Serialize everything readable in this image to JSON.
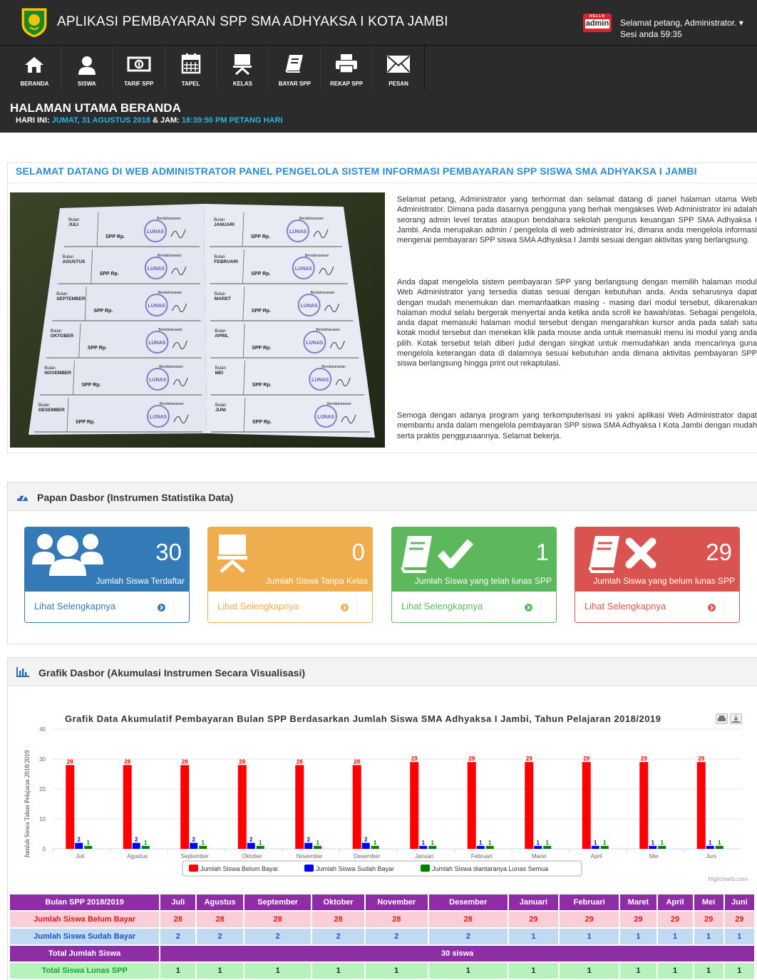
{
  "header": {
    "app_title": "APLIKASI PEMBAYARAN SPP SMA ADHYAKSA I KOTA JAMBI",
    "badge_hello": "HELLO",
    "badge_admin": "admin",
    "greeting": "Selamat petang, Administrator. ▾",
    "session": "Sesi anda 59:35"
  },
  "menu": [
    {
      "label": "BERANDA",
      "icon": "home-icon"
    },
    {
      "label": "SISWA",
      "icon": "user-icon"
    },
    {
      "label": "TARIF SPP",
      "icon": "money-icon"
    },
    {
      "label": "TAPEL",
      "icon": "calendar-icon"
    },
    {
      "label": "KELAS",
      "icon": "desk-icon"
    },
    {
      "label": "BAYAR SPP",
      "icon": "book-icon"
    },
    {
      "label": "REKAP SPP",
      "icon": "print-icon"
    },
    {
      "label": "PESAN",
      "icon": "envelope-icon"
    }
  ],
  "page": {
    "title": "HALAMAN UTAMA BERANDA",
    "date_prefix": "HARI INI: ",
    "date_value": "JUMAT, 31 AGUSTUS 2018",
    "time_prefix": " & JAM: ",
    "time_value": "18:39:50 PM PETANG HARI"
  },
  "welcome": {
    "title": "SELAMAT DATANG DI WEB ADMINISTRATOR PANEL PENGELOLA SISTEM INFORMASI PEMBAYARAN SPP SISWA SMA ADHYAKSA I JAMBI",
    "p1": "Selamat petang, Administrator yang terhormat dan selamat datang di panel halaman utama Web Administrator. Dimana pada dasarnya pengguna yang berhak mengakses Web Administrator ini adalah seorang admin level teratas ataupun bendahara sekolah pengurus keuangan SPP SMA Adhyaksa I Jambi. Anda merupakan admin / pengelola di web administrator ini, dimana anda mengelola informasi mengenai pembayaran SPP siswa SMA Adhyaksa I Jambi sesuai dengan aktivitas yang berlangsung.",
    "p2": "Anda dapat mengelola sistem pembayaran SPP yang berlangsung dengan memilih halaman modul Web Administrator yang tersedia diatas sesuai dengan kebutuhan anda. Anda seharusnya dapat dengan mudah menemukan dan memanfaatkan masing - masing dari modul tersebut, dikarenakan halaman modul selalu bergerak menyertai anda ketika anda scroll ke bawah/atas. Sebagai pengelola, anda dapat memasuki halaman modul tersebut dengan mengarahkan kursor anda pada salah satu kotak modul tersebut dan menekan klik pada mouse anda untuk memasuki menu isi modul yang anda pilih. Kotak tersebut telah diberi judul dengan singkat untuk memudahkan anda mencarinya guna mengelola keterangan data di dalamnya sesuai kebutuhan anda dimana aktivitas pembayaran SPP siswa berlangsung hingga print out rekaptulasi.",
    "p3": "Semoga dengan adanya program yang terkomputerisasi ini yakni aplikasi Web Administrator dapat membantu anda dalam mengelola pembayaran SPP siswa SMA Adhyaksa I Kota Jambi dengan mudah serta praktis penggunaannya. Selamat bekerja."
  },
  "photo": {
    "left_months": [
      "Bulan JULI",
      "Bulan AGUSTUS",
      "Bulan SEPTEMBER",
      "Bulan OKTOBER",
      "Bulan NOVEMBER",
      "Bulan DESEMBER"
    ],
    "right_months": [
      "Bulan JANUARI",
      "Bulan FEBRUARI",
      "Bulan MARET",
      "Bulan APRIL",
      "Bulan MEI",
      "Bulan JUNI"
    ],
    "spp": "SPP",
    "rp": "Rp.",
    "bendahara": "Bendaharawan",
    "stamp": "LUNAS"
  },
  "dashboard": {
    "title": "Papan Dasbor (Instrumen Statistika Data)",
    "cards": [
      {
        "value": "30",
        "caption": "Jumlah Siswa Terdaftar",
        "more": "Lihat Selengkapnya",
        "color": "#337ab7",
        "icon": "users-icon"
      },
      {
        "value": "0",
        "caption": "Jumlah Siswa Tanpa Kelas",
        "more": "Lihat Selengkapnya",
        "color": "#f0ad4e",
        "icon": "desk-icon"
      },
      {
        "value": "1",
        "caption": "Jumlah Siswa yang telah lunas SPP",
        "more": "Lihat Selengkapnya",
        "color": "#5cb85c",
        "icon": "book-check-icon"
      },
      {
        "value": "29",
        "caption": "Jumlah Siswa yang belum lunas SPP",
        "more": "Lihat Selengkapnya",
        "color": "#d9534f",
        "icon": "book-cross-icon"
      }
    ]
  },
  "graph_panel": {
    "title": "Grafik Dasbor (Akumulasi Instrumen Secara Visualisasi)"
  },
  "chart_data": {
    "type": "bar",
    "title": "Grafik Data Akumulatif Pembayaran Bulan SPP Berdasarkan Jumlah Siswa SMA Adhyaksa I Jambi, Tahun Pelajaran 2018/2019",
    "ylabel": "Jumlah Siswa Tahun Pelajaran 2018/2019",
    "xlabel": "",
    "ylim": [
      0,
      40
    ],
    "yticks": [
      0,
      10,
      20,
      30,
      40
    ],
    "categories": [
      "Juli",
      "Agustus",
      "September",
      "Oktober",
      "November",
      "Desember",
      "Januari",
      "Februari",
      "Maret",
      "April",
      "Mei",
      "Juni"
    ],
    "series": [
      {
        "name": "Jumlah Siswa Belum Bayar",
        "color": "#ff0000",
        "values": [
          28,
          28,
          28,
          28,
          28,
          28,
          29,
          29,
          29,
          29,
          29,
          29
        ]
      },
      {
        "name": "Jumlah Siswa Sudah Bayar",
        "color": "#0000ff",
        "values": [
          2,
          2,
          2,
          2,
          2,
          2,
          1,
          1,
          1,
          1,
          1,
          1
        ]
      },
      {
        "name": "Jumlah Siswa diantaranya Lunas Semua",
        "color": "#008000",
        "values": [
          1,
          1,
          1,
          1,
          1,
          1,
          1,
          1,
          1,
          1,
          1,
          1
        ]
      }
    ],
    "credit": "Highcharts.com",
    "legend_position": "bottom"
  },
  "table": {
    "header_label": "Bulan SPP 2018/2019",
    "months": [
      "Juli",
      "Agustus",
      "September",
      "Oktober",
      "November",
      "Desember",
      "Januari",
      "Februari",
      "Maret",
      "April",
      "Mei",
      "Juni"
    ],
    "row_belum_label": "Jumlah Siswa Belum Bayar",
    "row_belum": [
      "28",
      "28",
      "28",
      "28",
      "28",
      "28",
      "29",
      "29",
      "29",
      "29",
      "29",
      "29"
    ],
    "row_sudah_label": "Jumlah Siswa Sudah Bayar",
    "row_sudah": [
      "2",
      "2",
      "2",
      "2",
      "2",
      "2",
      "1",
      "1",
      "1",
      "1",
      "1",
      "1"
    ],
    "row_total_label": "Total Jumlah Siswa",
    "row_total_value": "30 siswa",
    "row_lunas_label": "Total Siswa Lunas SPP",
    "row_lunas": [
      "1",
      "1",
      "1",
      "1",
      "1",
      "1",
      "1",
      "1",
      "1",
      "1",
      "1",
      "1"
    ]
  }
}
